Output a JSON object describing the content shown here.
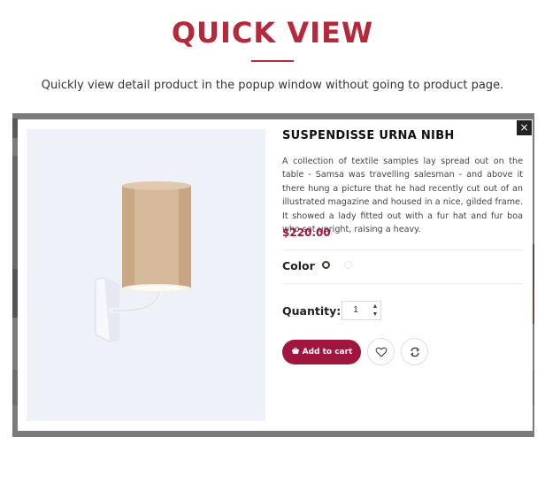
{
  "header": {
    "title": "QUICK VIEW",
    "subtitle": "Quickly view detail product in the popup window without going to product page."
  },
  "modal": {
    "close_label": "×",
    "product": {
      "name": "SUSPENDISSE URNA NIBH",
      "description": "A collection of textile samples lay spread out on the table - Samsa was travelling salesman - and above it there hung a picture that he had recently cut out of an illustrated magazine and housed in a nice, gilded frame. It showed a lady fitted out with a fur hat and fur boa who sat upright, raising a heavy.",
      "price": "$220.00",
      "image_icon": "wall-lamp-image"
    },
    "color": {
      "label": "Color",
      "options": [
        "#3a3a2a",
        "#ffffff"
      ]
    },
    "quantity": {
      "label": "Quantity:",
      "value": "1"
    },
    "actions": {
      "add_to_cart_label": "Add to cart",
      "add_to_cart_icon": "cart-icon",
      "wishlist_icon": "heart-icon",
      "compare_icon": "compare-icon"
    }
  },
  "colors": {
    "accent": "#b5293b",
    "button": "#a0163f"
  }
}
